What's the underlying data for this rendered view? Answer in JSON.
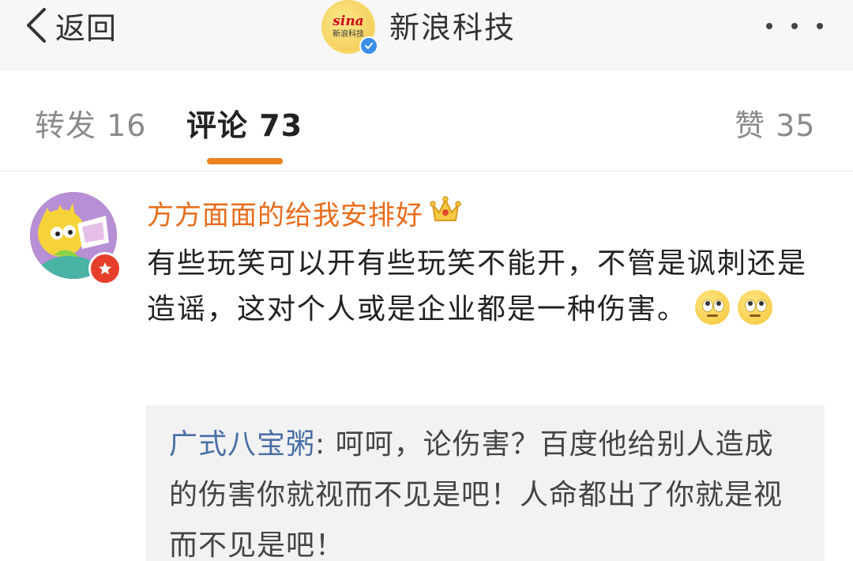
{
  "navbar": {
    "back_label": "返回",
    "logo_text": "sina",
    "logo_subtext": "新浪科技",
    "account_name": "新浪科技"
  },
  "tabs": {
    "repost": "转发 16",
    "comment": "评论 73",
    "like": "赞 35",
    "active": "comment",
    "active_color": "#f08120"
  },
  "comment": {
    "username": "方方面面的给我安排好",
    "username_color": "#e96b1a",
    "text": "有些玩笑可以开有些玩笑不能开，不管是讽刺还是造谣，这对个人或是企业都是一种伤害。",
    "reply": {
      "user": "广式八宝粥",
      "separator": ": ",
      "text": "呵呵，论伤害？百度他给别人造成的伤害你就视而不见是吧！人命都出了你就是视而不见是吧！"
    }
  }
}
